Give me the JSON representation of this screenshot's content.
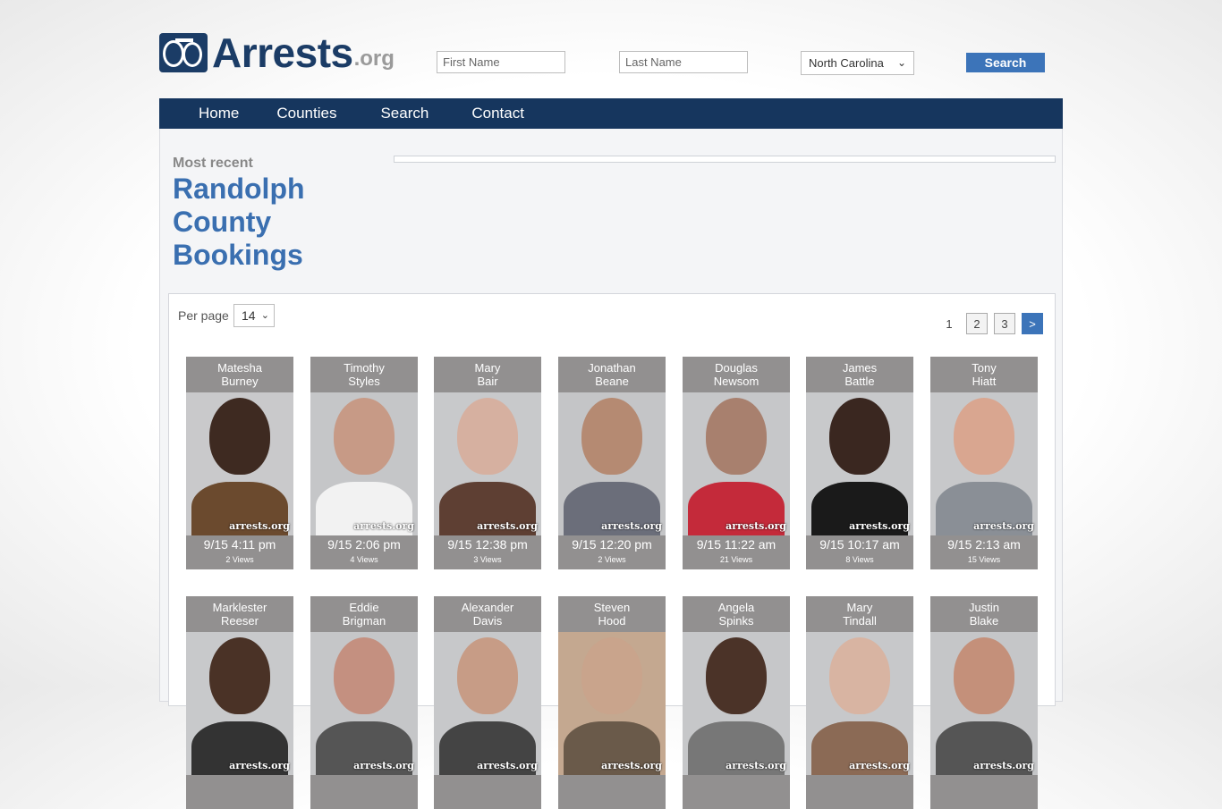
{
  "header": {
    "logo_text": "Arrests",
    "logo_suffix": ".org",
    "first_name_placeholder": "First Name",
    "last_name_placeholder": "Last Name",
    "state_selected": "North Carolina",
    "search_label": "Search"
  },
  "nav": {
    "items": [
      "Home",
      "Counties",
      "Search",
      "Contact"
    ]
  },
  "main": {
    "kicker": "Most recent",
    "heading": "Randolph County Bookings",
    "per_page_label": "Per page",
    "per_page_value": "14",
    "pages": [
      "1",
      "2",
      "3",
      ">"
    ]
  },
  "bookings": [
    {
      "first": "Matesha",
      "last": "Burney",
      "time": "9/15 4:11 pm",
      "views": "2 Views",
      "bg": "#c9c9cb",
      "skin": "#3e2a21",
      "shirt": "#6b4a2e"
    },
    {
      "first": "Timothy",
      "last": "Styles",
      "time": "9/15 2:06 pm",
      "views": "4 Views",
      "bg": "#c5c6c8",
      "skin": "#c79a86",
      "shirt": "#f2f2f2"
    },
    {
      "first": "Mary",
      "last": "Bair",
      "time": "9/15 12:38 pm",
      "views": "3 Views",
      "bg": "#c8c9cb",
      "skin": "#d6b0a0",
      "shirt": "#5e3f33"
    },
    {
      "first": "Jonathan",
      "last": "Beane",
      "time": "9/15 12:20 pm",
      "views": "2 Views",
      "bg": "#c4c5c7",
      "skin": "#b58a72",
      "shirt": "#6b6e7a"
    },
    {
      "first": "Douglas",
      "last": "Newsom",
      "time": "9/15 11:22 am",
      "views": "21 Views",
      "bg": "#c6c7c9",
      "skin": "#a8806e",
      "shirt": "#c42a3a"
    },
    {
      "first": "James",
      "last": "Battle",
      "time": "9/15 10:17 am",
      "views": "8 Views",
      "bg": "#c8c9cb",
      "skin": "#3a2720",
      "shirt": "#1a1a1a"
    },
    {
      "first": "Tony",
      "last": "Hiatt",
      "time": "9/15 2:13 am",
      "views": "15 Views",
      "bg": "#c7c8ca",
      "skin": "#d9a690",
      "shirt": "#8a8f96"
    },
    {
      "first": "Marklester",
      "last": "Reeser",
      "time": "",
      "views": "",
      "bg": "#c8c9cb",
      "skin": "#4a3226",
      "shirt": "#333333"
    },
    {
      "first": "Eddie",
      "last": "Brigman",
      "time": "",
      "views": "",
      "bg": "#c5c6c8",
      "skin": "#c49080",
      "shirt": "#555555"
    },
    {
      "first": "Alexander",
      "last": "Davis",
      "time": "",
      "views": "",
      "bg": "#c7c8ca",
      "skin": "#c79c86",
      "shirt": "#444444"
    },
    {
      "first": "Steven",
      "last": "Hood",
      "time": "",
      "views": "",
      "bg": "#c4a890",
      "skin": "#c9a48c",
      "shirt": "#6a5a4a"
    },
    {
      "first": "Angela",
      "last": "Spinks",
      "time": "",
      "views": "",
      "bg": "#c6c7c9",
      "skin": "#4b3328",
      "shirt": "#777777"
    },
    {
      "first": "Mary",
      "last": "Tindall",
      "time": "",
      "views": "",
      "bg": "#c7c8ca",
      "skin": "#d8b4a2",
      "shirt": "#8b6a55"
    },
    {
      "first": "Justin",
      "last": "Blake",
      "time": "",
      "views": "",
      "bg": "#c5c6c8",
      "skin": "#c4907a",
      "shirt": "#555555"
    }
  ],
  "watermark": "arrests.org",
  "colors": {
    "nav": "#16365e",
    "accent": "#3a6fb0",
    "button": "#3c74b9",
    "card": "#929090"
  }
}
